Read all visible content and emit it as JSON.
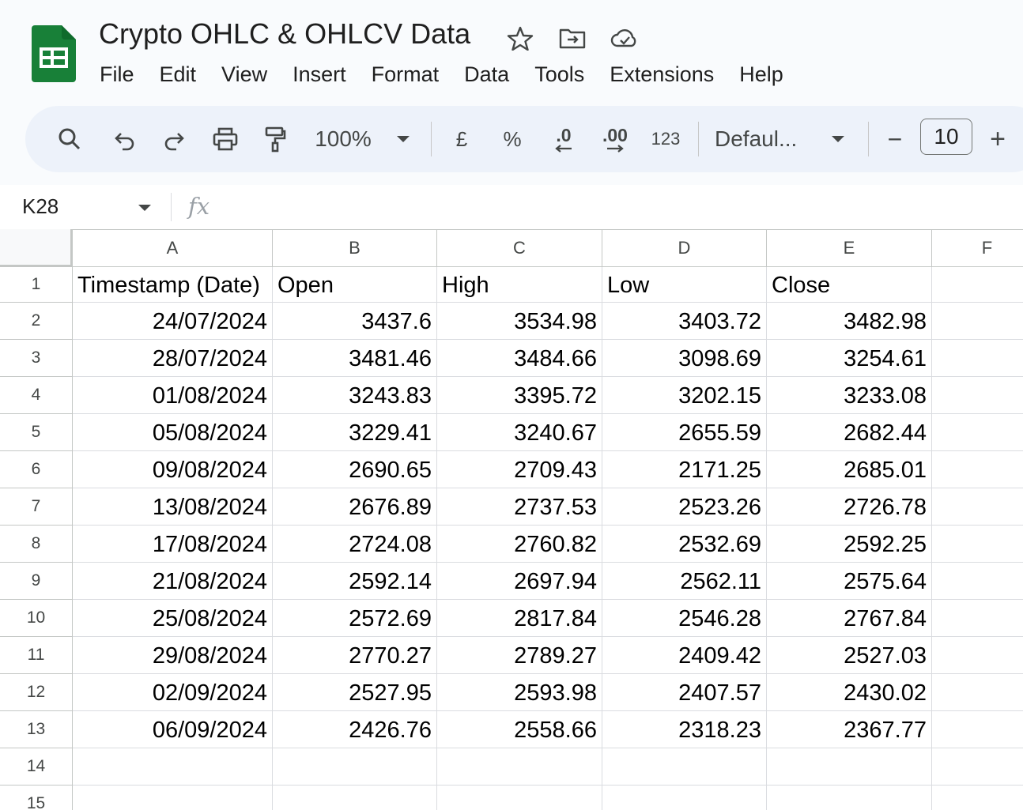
{
  "app": {
    "title": "Crypto OHLC & OHLCV Data",
    "title_icons": [
      "star-icon",
      "move-to-folder-icon",
      "cloud-saved-icon"
    ],
    "menu": [
      "File",
      "Edit",
      "View",
      "Insert",
      "Format",
      "Data",
      "Tools",
      "Extensions",
      "Help"
    ]
  },
  "toolbar": {
    "zoom": "100%",
    "currency": "£",
    "percent": "%",
    "decrease_decimals": ".0",
    "increase_decimals": ".00",
    "more_formats": "123",
    "font": "Defaul...",
    "font_size": "10",
    "minus": "−",
    "plus": "+"
  },
  "formula_bar": {
    "cell_ref": "K28",
    "fx": "fx",
    "value": ""
  },
  "sheet": {
    "columns": [
      "A",
      "B",
      "C",
      "D",
      "E",
      "F"
    ],
    "row_numbers": [
      "1",
      "2",
      "3",
      "4",
      "5",
      "6",
      "7",
      "8",
      "9",
      "10",
      "11",
      "12",
      "13",
      "14",
      "15"
    ],
    "headers": [
      "Timestamp (Date)",
      "Open",
      "High",
      "Low",
      "Close"
    ],
    "rows": [
      [
        "24/07/2024",
        "3437.6",
        "3534.98",
        "3403.72",
        "3482.98"
      ],
      [
        "28/07/2024",
        "3481.46",
        "3484.66",
        "3098.69",
        "3254.61"
      ],
      [
        "01/08/2024",
        "3243.83",
        "3395.72",
        "3202.15",
        "3233.08"
      ],
      [
        "05/08/2024",
        "3229.41",
        "3240.67",
        "2655.59",
        "2682.44"
      ],
      [
        "09/08/2024",
        "2690.65",
        "2709.43",
        "2171.25",
        "2685.01"
      ],
      [
        "13/08/2024",
        "2676.89",
        "2737.53",
        "2523.26",
        "2726.78"
      ],
      [
        "17/08/2024",
        "2724.08",
        "2760.82",
        "2532.69",
        "2592.25"
      ],
      [
        "21/08/2024",
        "2592.14",
        "2697.94",
        "2562.11",
        "2575.64"
      ],
      [
        "25/08/2024",
        "2572.69",
        "2817.84",
        "2546.28",
        "2767.84"
      ],
      [
        "29/08/2024",
        "2770.27",
        "2789.27",
        "2409.42",
        "2527.03"
      ],
      [
        "02/09/2024",
        "2527.95",
        "2593.98",
        "2407.57",
        "2430.02"
      ],
      [
        "06/09/2024",
        "2426.76",
        "2558.66",
        "2318.23",
        "2367.77"
      ]
    ]
  },
  "colors": {
    "sheets_green": "#188038",
    "header_bg": "#f9fbfd",
    "toolbar_bg": "#edf2fa"
  }
}
